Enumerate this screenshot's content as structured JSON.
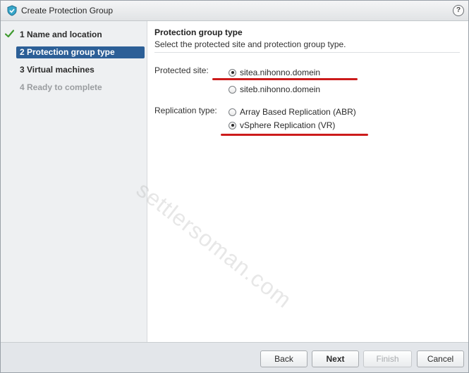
{
  "window": {
    "title": "Create Protection Group",
    "help_glyph": "?"
  },
  "steps": [
    {
      "label": "1  Name and location",
      "state": "completed"
    },
    {
      "label": "2  Protection group type",
      "state": "active"
    },
    {
      "label": "3  Virtual machines",
      "state": "pending"
    },
    {
      "label": "4  Ready to complete",
      "state": "disabled"
    }
  ],
  "content": {
    "title": "Protection group type",
    "subtitle": "Select the protected site and protection group type.",
    "protected_site": {
      "label": "Protected site:",
      "options": [
        {
          "label": "sitea.nihonno.domein",
          "checked": true
        },
        {
          "label": "siteb.nihonno.domein",
          "checked": false
        }
      ]
    },
    "replication_type": {
      "label": "Replication type:",
      "options": [
        {
          "label": "Array Based Replication (ABR)",
          "checked": false
        },
        {
          "label": "vSphere Replication (VR)",
          "checked": true
        }
      ]
    },
    "watermark": "settlersoman.com"
  },
  "footer": {
    "back_label": "Back",
    "next_label": "Next",
    "finish_label": "Finish",
    "cancel_label": "Cancel"
  },
  "colors": {
    "active_step": "#2c5f97",
    "check": "#3f9a2f",
    "annotation": "#cc1b1b"
  }
}
